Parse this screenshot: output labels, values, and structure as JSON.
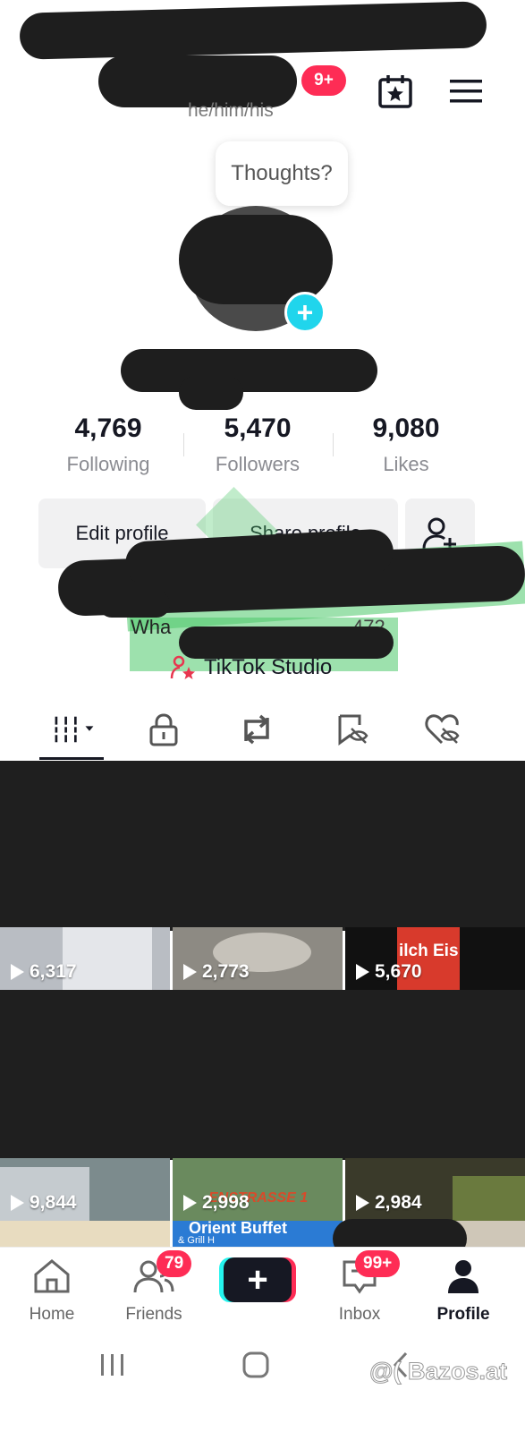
{
  "header": {
    "pronouns": "he/him/his",
    "notification_badge": "9+",
    "calendar_icon": "calendar-star-icon",
    "menu_icon": "hamburger-menu-icon"
  },
  "profile": {
    "thoughts_prompt": "Thoughts?",
    "avatar_add_icon": "plus-icon"
  },
  "stats": [
    {
      "value": "4,769",
      "label": "Following"
    },
    {
      "value": "5,470",
      "label": "Followers"
    },
    {
      "value": "9,080",
      "label": "Likes"
    }
  ],
  "buttons": {
    "edit_profile": "Edit profile",
    "share_profile": "Share profile",
    "add_friend_icon": "add-person-icon"
  },
  "bio": {
    "partial_text": "Wha",
    "partial_number": "472"
  },
  "studio": {
    "label": "TikTok Studio",
    "icon": "person-star-icon"
  },
  "tabs": [
    {
      "name": "videos",
      "icon": "grid-icon"
    },
    {
      "name": "private",
      "icon": "lock-icon"
    },
    {
      "name": "reposts",
      "icon": "repost-icon"
    },
    {
      "name": "favorites",
      "icon": "bookmark-hidden-icon"
    },
    {
      "name": "liked",
      "icon": "heart-hidden-icon"
    }
  ],
  "videos": {
    "row1": [
      "6,317",
      "2,773",
      "5,670"
    ],
    "row2": [
      "9,844",
      "2,998",
      "2,984"
    ],
    "thumb_text": {
      "row1_col3": "ilch Eis",
      "row2_col2": "ENSTRASSE 1",
      "row3_col2": "Orient Buffet",
      "row3_col2_sub": "& Grill H"
    }
  },
  "bottom_nav": {
    "home": "Home",
    "friends": "Friends",
    "friends_badge": "79",
    "inbox": "Inbox",
    "inbox_badge": "99+",
    "profile": "Profile"
  },
  "watermark": "@( Bazos.at",
  "colors": {
    "accent": "#fe2c55",
    "cyan": "#20d5ec",
    "redaction": "#1e1e1e"
  }
}
